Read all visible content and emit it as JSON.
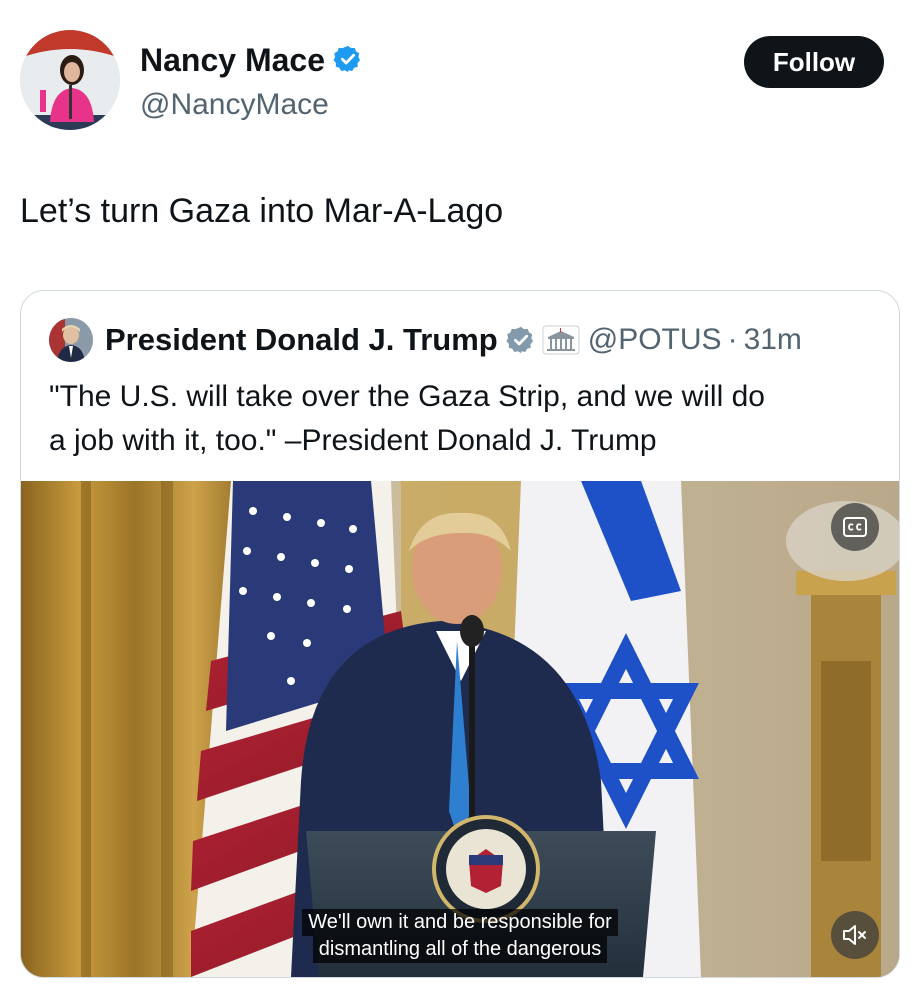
{
  "author": {
    "name": "Nancy Mace",
    "handle": "@NancyMace",
    "avatar_icon": "profile-photo",
    "verified_icon": "verified-badge-icon"
  },
  "follow_button": {
    "label": "Follow"
  },
  "tweet": {
    "text": "Let’s turn Gaza into Mar-A-Lago"
  },
  "quoted_tweet": {
    "author_name": "President Donald J. Trump",
    "handle": "@POTUS",
    "separator": "·",
    "time": "31m",
    "text_lines": [
      "\"The U.S. will take over the Gaza Strip, and we will do",
      "a job with it, too.\" –President Donald J. Trump"
    ],
    "badges": [
      "verified-badge-icon",
      "white-house-icon"
    ]
  },
  "video": {
    "caption_lines": [
      "We'll own it and be responsible for",
      "dismantling all of the dangerous"
    ],
    "cc_icon": "closed-captions-icon",
    "mute_icon": "muted-speaker-icon"
  },
  "colors": {
    "verified": "#1d9bf0",
    "follow_bg": "#0f1419",
    "handle": "#536471",
    "border": "#cfd9de"
  }
}
